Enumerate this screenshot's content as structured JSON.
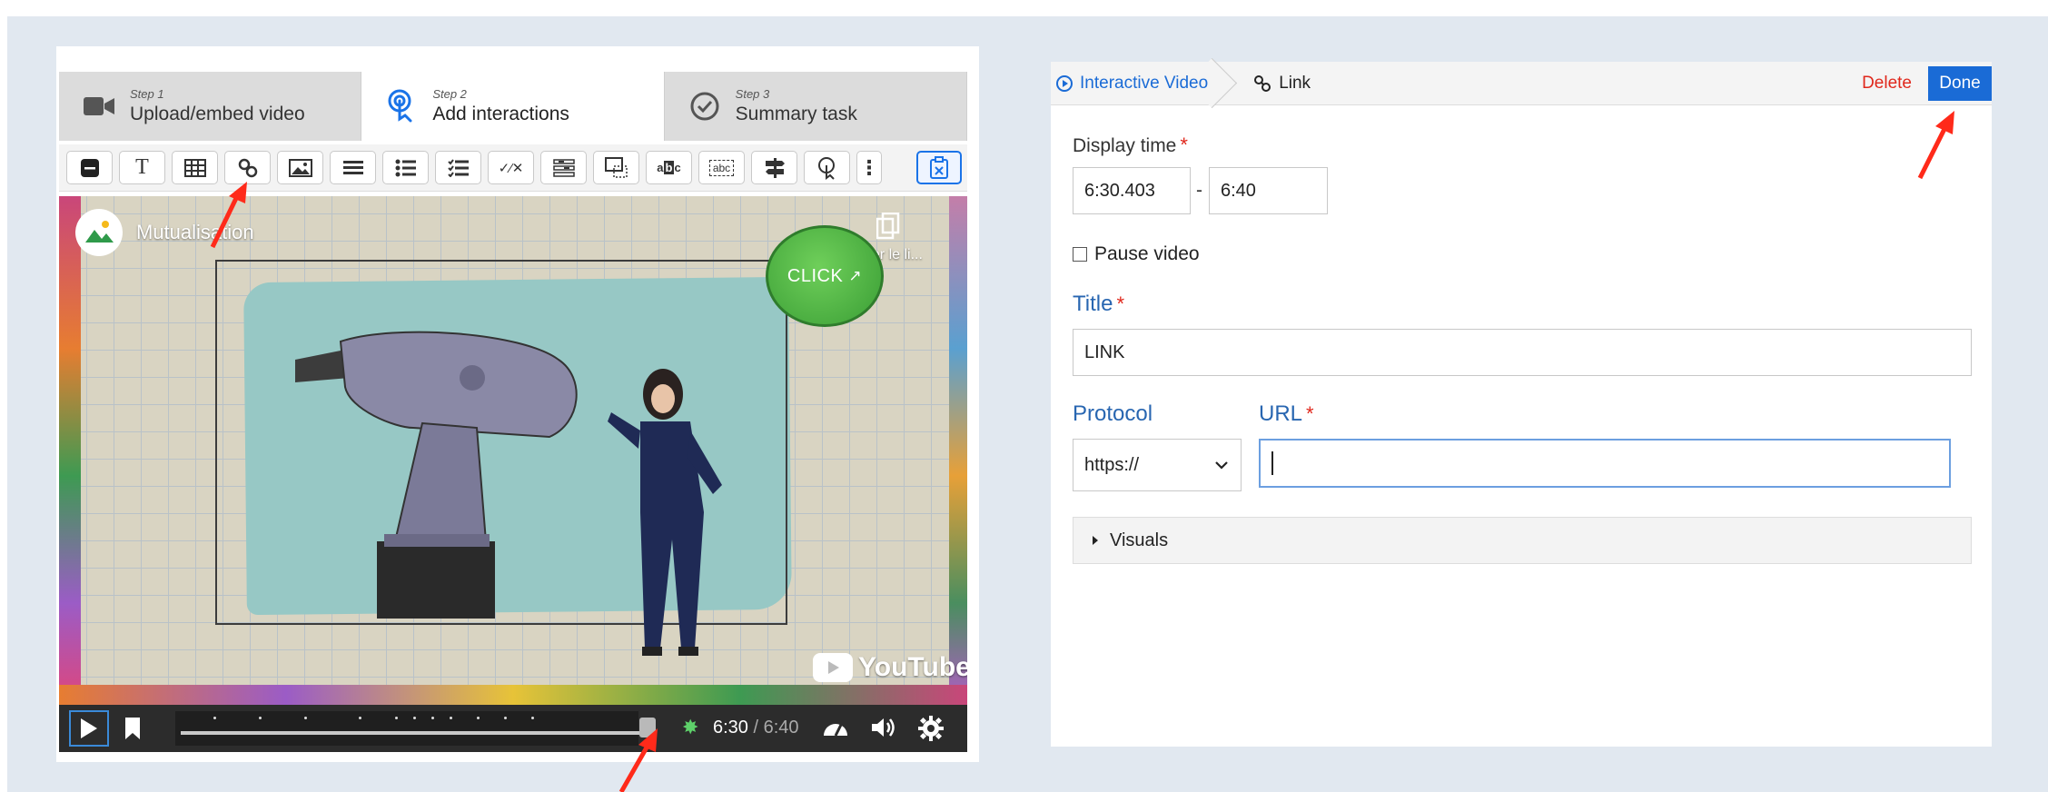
{
  "steps": [
    {
      "num": "Step 1",
      "name": "Upload/embed video",
      "icon": "video-camera-icon"
    },
    {
      "num": "Step 2",
      "name": "Add interactions",
      "icon": "tap-icon"
    },
    {
      "num": "Step 3",
      "name": "Summary task",
      "icon": "check-circle-icon"
    }
  ],
  "toolbar_tools": [
    "label",
    "text",
    "table",
    "link",
    "image",
    "statements",
    "single-choice",
    "multiple-choice",
    "fill-blanks",
    "drag-drop",
    "mark-words",
    "drag-text",
    "crossroads",
    "navigation-hotspot",
    "more"
  ],
  "video": {
    "channel": "Mutualisation",
    "copy_label": "Copier le li...",
    "click_label": "CLICK",
    "youtube_label": "YouTube",
    "time_current": "6:30",
    "time_sep": "/",
    "time_duration": "6:40",
    "progress_fraction": 0.975
  },
  "editor": {
    "breadcrumb_root": "Interactive Video",
    "breadcrumb_current": "Link",
    "delete_label": "Delete",
    "done_label": "Done",
    "display_time_label": "Display time",
    "required_mark": "*",
    "time_start": "6:30.403",
    "time_dash": "-",
    "time_end": "6:40",
    "pause_label": "Pause video",
    "title_label": "Title",
    "title_value": "LINK",
    "protocol_label": "Protocol",
    "protocol_value": "https://",
    "url_label": "URL",
    "url_value": "",
    "visuals_label": "Visuals"
  },
  "colors": {
    "accent": "#1a6bd6",
    "danger": "#e0281c",
    "label_blue": "#2866b1",
    "arrow": "#ff2a1a",
    "background": "#e1e8f0"
  }
}
